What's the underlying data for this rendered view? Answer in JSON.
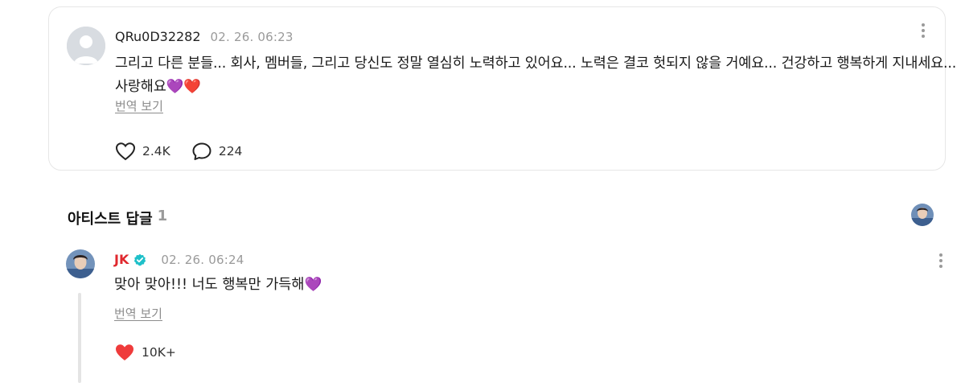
{
  "comment": {
    "username": "QRu0D32282",
    "timestamp": "02. 26. 06:23",
    "body": "그리고 다른 분들... 회사, 멤버들, 그리고 당신도 정말 열심히 노력하고 있어요... 노력은 결코 헛되지 않을 거예요... 건강하고 행복하게 지내세요... 사랑해요💜❤️",
    "translate_label": "번역 보기",
    "likes": "2.4K",
    "replies": "224"
  },
  "artist_replies": {
    "title": "아티스트 답글",
    "count": "1",
    "reply": {
      "name": "JK",
      "timestamp": "02. 26. 06:24",
      "body": "맞아 맞아!!! 너도 행복만 가득해💜",
      "translate_label": "번역 보기",
      "likes": "10K+"
    }
  },
  "colors": {
    "artist_name": "#e0282e",
    "verified_badge": "#1ec0c9",
    "heart_filled": "#ef3b3b",
    "muted_text": "#9a9a9a"
  },
  "icons": {
    "like": "heart-outline-icon",
    "reply": "speech-bubble-icon",
    "more": "more-vertical-icon",
    "verified": "verified-badge-icon",
    "liked": "heart-filled-icon"
  }
}
